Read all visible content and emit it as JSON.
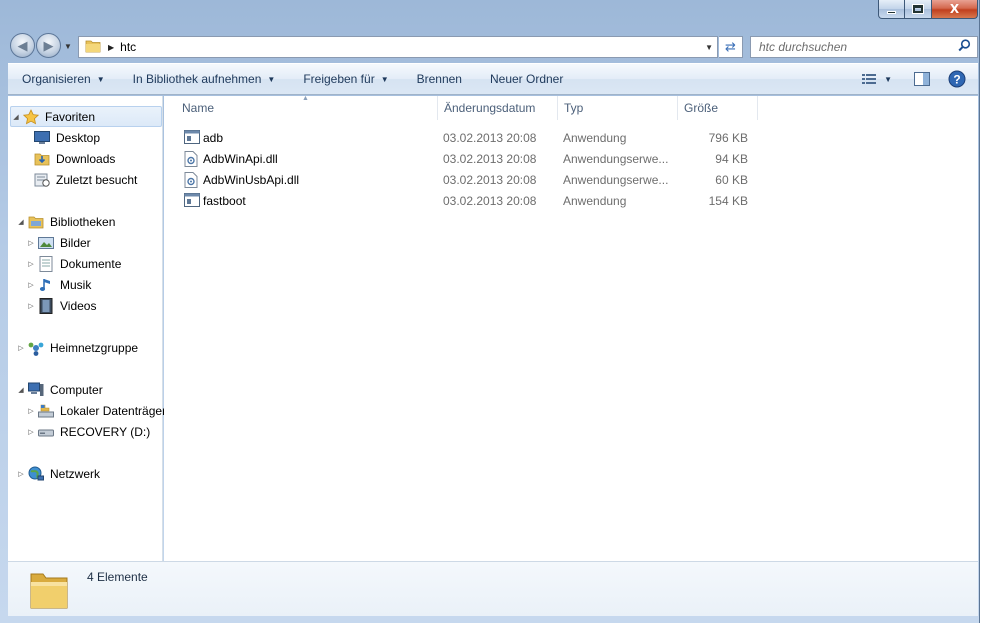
{
  "window": {
    "close_glyph": "X"
  },
  "address": {
    "path": "htc",
    "search_placeholder": "htc durchsuchen"
  },
  "toolbar": {
    "organize": "Organisieren",
    "library": "In Bibliothek aufnehmen",
    "share": "Freigeben für",
    "burn": "Brennen",
    "new_folder": "Neuer Ordner"
  },
  "nav": {
    "favorites": "Favoriten",
    "desktop": "Desktop",
    "downloads": "Downloads",
    "recent": "Zuletzt besucht",
    "libraries": "Bibliotheken",
    "pictures": "Bilder",
    "documents": "Dokumente",
    "music": "Musik",
    "videos": "Videos",
    "homegroup": "Heimnetzgruppe",
    "computer": "Computer",
    "local_disk": "Lokaler Datenträger",
    "recovery": "RECOVERY (D:)",
    "network": "Netzwerk"
  },
  "columns": {
    "name": "Name",
    "date": "Änderungsdatum",
    "type": "Typ",
    "size": "Größe"
  },
  "files": [
    {
      "name": "adb",
      "date": "03.02.2013 20:08",
      "type": "Anwendung",
      "size": "796 KB",
      "icon": "exe-icon"
    },
    {
      "name": "AdbWinApi.dll",
      "date": "03.02.2013 20:08",
      "type": "Anwendungserwe...",
      "size": "94 KB",
      "icon": "dll-icon"
    },
    {
      "name": "AdbWinUsbApi.dll",
      "date": "03.02.2013 20:08",
      "type": "Anwendungserwe...",
      "size": "60 KB",
      "icon": "dll-icon"
    },
    {
      "name": "fastboot",
      "date": "03.02.2013 20:08",
      "type": "Anwendung",
      "size": "154 KB",
      "icon": "exe-icon"
    }
  ],
  "details": {
    "count": "4 Elemente"
  },
  "colors": {
    "frame": "#b5cbe6",
    "toolbar_text": "#1e395b",
    "muted_text": "#6d6d6d",
    "selection": "#dce9f8"
  }
}
